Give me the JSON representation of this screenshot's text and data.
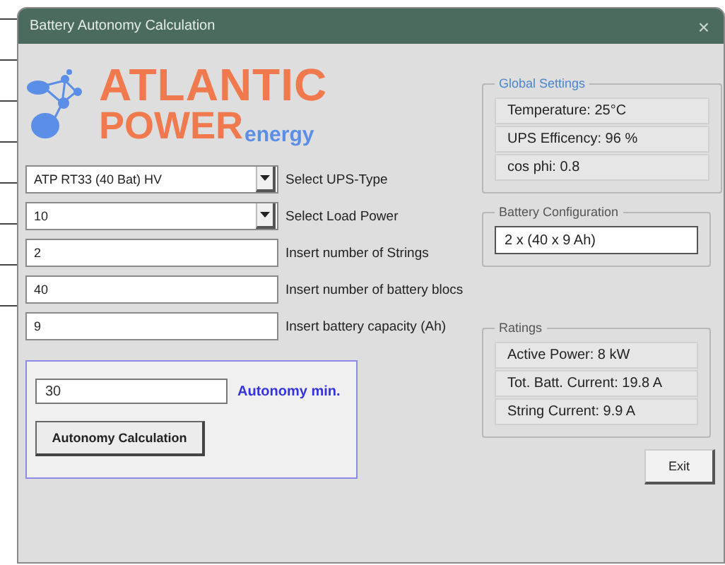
{
  "window": {
    "title": "Battery Autonomy Calculation",
    "close": "×"
  },
  "logo": {
    "line1": "ATLANTIC",
    "line2": "POWER",
    "suffix": "energy"
  },
  "inputs": [
    {
      "kind": "dropdown",
      "value": "ATP RT33 (40 Bat) HV",
      "label": "Select UPS-Type"
    },
    {
      "kind": "dropdown",
      "value": "10",
      "label": "Select Load Power"
    },
    {
      "kind": "text",
      "value": "2",
      "label": "Insert number of Strings"
    },
    {
      "kind": "text",
      "value": "40",
      "label": "Insert number of battery blocs"
    },
    {
      "kind": "text",
      "value": "9",
      "label": "Insert battery capacity (Ah)"
    }
  ],
  "autonomy": {
    "value": "30",
    "label": "Autonomy min.",
    "button": "Autonomy Calculation"
  },
  "global_settings": {
    "title": "Global Settings",
    "rows": [
      "Temperature: 25°C",
      "UPS Efficency: 96 %",
      "cos phi: 0.8"
    ]
  },
  "battery_configuration": {
    "title": "Battery Configuration",
    "value": "2 x (40 x 9 Ah)"
  },
  "ratings": {
    "title": "Ratings",
    "rows": [
      "Active Power: 8 kW",
      "Tot. Batt. Current: 19.8 A",
      "String Current: 9.9 A"
    ]
  },
  "buttons": [
    "Exit"
  ]
}
